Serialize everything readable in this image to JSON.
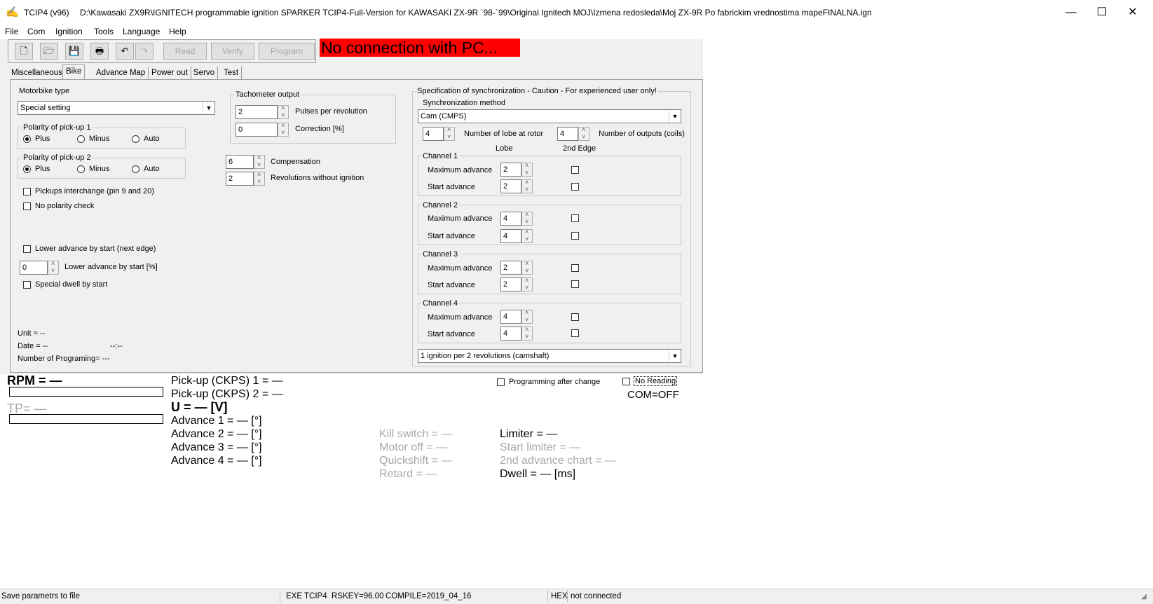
{
  "window": {
    "app_title": "TCIP4 (v96)",
    "file_path": "D:\\Kawasaki ZX9R\\IGNITECH programmable ignition SPARKER TCIP4-Full-Version for KAWASAKI ZX-9R `98-`99\\Original Ignitech MOJ\\Izmena redosleda\\Moj ZX-9R Po fabrickim vrednostima mapeFINALNA.ign",
    "minimize": "—",
    "maximize": "☐",
    "close": "✕"
  },
  "menu": [
    "File",
    "Com",
    "Ignition",
    "Tools",
    "Language",
    "Help"
  ],
  "toolbar": {
    "read_label": "Read",
    "verify_label": "Verify",
    "program_label": "Program",
    "icons": [
      "new-icon",
      "open-icon",
      "save-icon",
      "print-icon",
      "undo-icon",
      "redo-icon"
    ]
  },
  "connection_banner": "No connection with PC...",
  "tabs": [
    "Miscellaneous",
    "Bike",
    "Advance Map",
    "Power out",
    "Servo",
    "Test"
  ],
  "active_tab": "Bike",
  "bike": {
    "motorbike_type_label": "Motorbike type",
    "motorbike_type_value": "Special setting",
    "polarity1": {
      "title": "Polarity of pick-up 1",
      "options": [
        "Plus",
        "Minus",
        "Auto"
      ],
      "selected": "Plus"
    },
    "polarity2": {
      "title": "Polarity of pick-up 2",
      "options": [
        "Plus",
        "Minus",
        "Auto"
      ],
      "selected": "Plus"
    },
    "pickups_interchange": "Pickups interchange (pin 9 and 20)",
    "no_polarity_check": "No polarity check",
    "lower_advance_next_edge": "Lower advance by start (next edge)",
    "lower_advance_pct_value": "0",
    "lower_advance_pct_label": "Lower advance by start [%]",
    "special_dwell": "Special dwell by start",
    "unit": "Unit = --",
    "date": "Date = --",
    "date_extra": "--:--",
    "num_programing": "Number of Programing= ---",
    "tacho": {
      "title": "Tachometer output",
      "pulses_value": "2",
      "pulses_label": "Pulses per revolution",
      "correction_value": "0",
      "correction_label": "Correction [%]"
    },
    "compensation_value": "6",
    "compensation_label": "Compensation",
    "rev_without_ign_value": "2",
    "rev_without_ign_label": "Revolutions without ignition",
    "sync": {
      "title": "Specification of synchronization - Caution - For experienced user only!",
      "method_label": "Synchronization method",
      "method_value": "Cam (CMPS)",
      "lobe_value": "4",
      "lobe_label": "Number of lobe at rotor",
      "outputs_value": "4",
      "outputs_label": "Number of outputs (coils)",
      "col_lobe": "Lobe",
      "col_2nd_edge": "2nd Edge",
      "channels": [
        {
          "title": "Channel 1",
          "max_label": "Maximum advance",
          "max_value": "2",
          "start_label": "Start advance",
          "start_value": "2"
        },
        {
          "title": "Channel 2",
          "max_label": "Maximum advance",
          "max_value": "4",
          "start_label": "Start advance",
          "start_value": "4"
        },
        {
          "title": "Channel 3",
          "max_label": "Maximum advance",
          "max_value": "2",
          "start_label": "Start advance",
          "start_value": "2"
        },
        {
          "title": "Channel 4",
          "max_label": "Maximum advance",
          "max_value": "4",
          "start_label": "Start advance",
          "start_value": "4"
        }
      ],
      "ignition_mode": "1 ignition per 2 revolutions (camshaft)"
    }
  },
  "readouts": {
    "rpm": "RPM = —",
    "tp": "TP= —",
    "pickup1": "Pick-up (CKPS) 1 =  —",
    "pickup2": "Pick-up (CKPS) 2 =  —",
    "voltage": "U = — [V]",
    "adv1": "Advance 1 = — [°]",
    "adv2": "Advance 2 = — [°]",
    "adv3": "Advance 3 = — [°]",
    "adv4": "Advance 4 = — [°]",
    "kill_switch": "Kill switch = —",
    "motor_off": "Motor off = —",
    "quickshift": "Quickshift = —",
    "retard": "Retard = —",
    "limiter": "Limiter = —",
    "start_limiter": "Start limiter = —",
    "second_chart": "2nd advance chart = —",
    "dwell": "Dwell = — [ms]",
    "programming_after_change": "Programming after change",
    "no_reading": "No Reading",
    "com_status": "COM=OFF"
  },
  "statusbar": {
    "hint": "Save parametrs to file",
    "exe": "EXE",
    "name": "TCIP4",
    "rskey": "RSKEY=96.00",
    "compile": "COMPILE=2019_04_16",
    "hex": "HEX",
    "conn": "not connected"
  },
  "colors": {
    "banner_bg": "#ff0000",
    "workspace_bg": "#f0f0f0",
    "disabled_text": "#a8a8a8"
  }
}
